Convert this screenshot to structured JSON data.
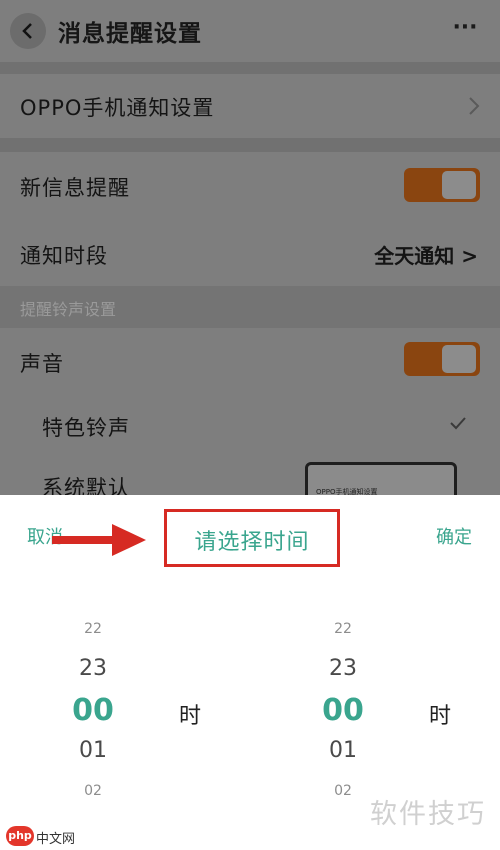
{
  "header": {
    "title": "消息提醒设置",
    "more_label": "···"
  },
  "settings": {
    "oppo_label": "OPPO手机通知设置",
    "new_msg_label": "新信息提醒",
    "notify_period_label": "通知时段",
    "notify_period_value": "全天通知 >",
    "section_label": "提醒铃声设置",
    "sound_label": "声音",
    "ringtone_label": "特色铃声",
    "default_label": "系统默认",
    "preview_text": "OPPO手机通知设置",
    "toggle_color": "#8a4510"
  },
  "picker": {
    "cancel_label": "取消",
    "title": "请选择时间",
    "confirm_label": "确定",
    "hours": [
      "22",
      "23",
      "00",
      "01",
      "02"
    ],
    "minutes": [
      "22",
      "23",
      "00",
      "01",
      "02"
    ],
    "hour_unit": "时",
    "minute_unit": "时",
    "accent_color": "#3aa58e",
    "highlight_color": "#d62a23"
  },
  "watermark": {
    "logo_text": "php",
    "site_text": "中文网",
    "right_text": "软件技巧"
  }
}
